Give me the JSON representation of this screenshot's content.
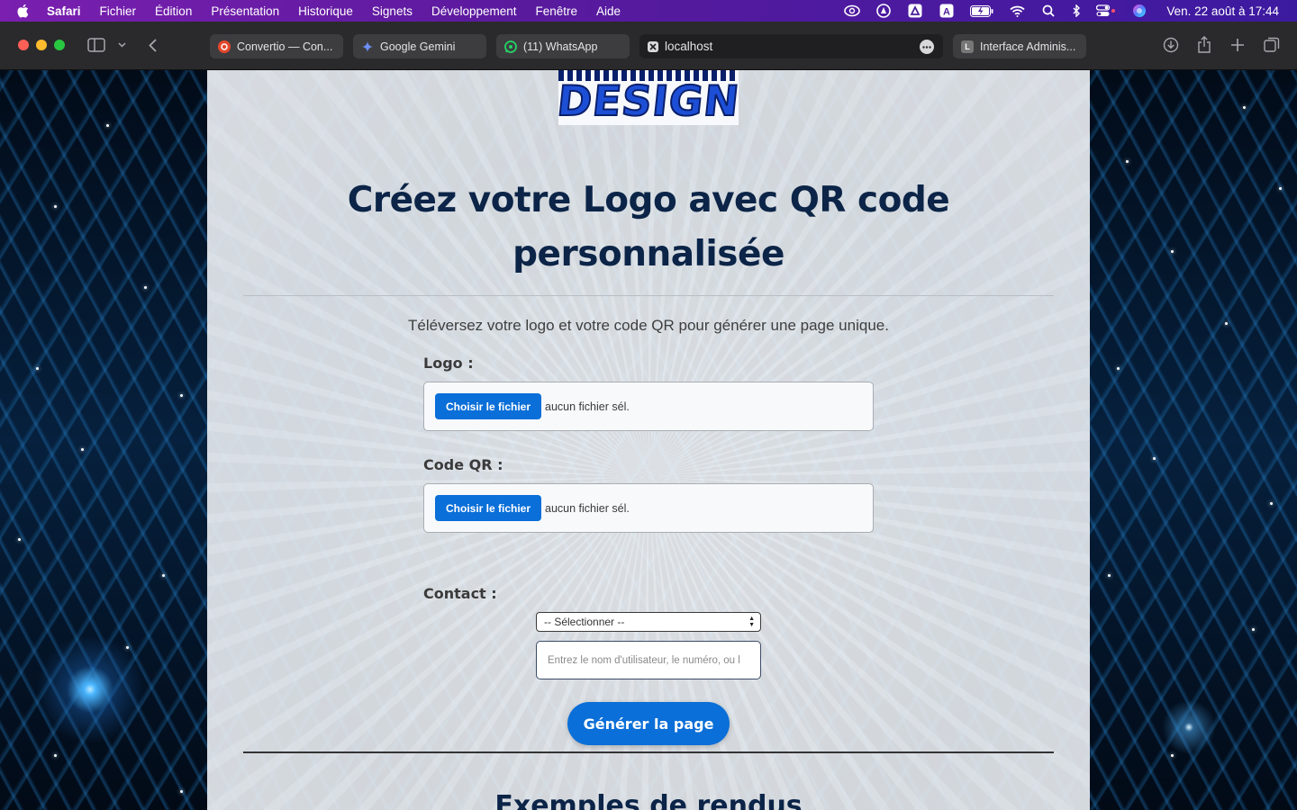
{
  "menubar": {
    "app_name": "Safari",
    "items": [
      "Fichier",
      "Édition",
      "Présentation",
      "Historique",
      "Signets",
      "Développement",
      "Fenêtre",
      "Aide"
    ],
    "status_icons": [
      "creative-cloud-icon",
      "vpn-icon",
      "drive-icon",
      "keyboard-a-icon",
      "battery-icon",
      "wifi-icon",
      "search-icon",
      "bluetooth-icon",
      "control-center-icon",
      "siri-icon"
    ],
    "datetime": "Ven. 22 août à  17:44"
  },
  "toolbar": {
    "tabs": [
      {
        "title": "Convertio — Con...",
        "favicon": "convertio-icon",
        "color": "#e4472c"
      },
      {
        "title": "Google Gemini",
        "favicon": "gemini-icon",
        "color": "#4d86f2"
      },
      {
        "title": "(11) WhatsApp",
        "favicon": "whatsapp-icon",
        "color": "#25d366"
      },
      {
        "title": "localhost",
        "favicon": "close-icon",
        "color": "#ffffff"
      },
      {
        "title": "Interface Adminis...",
        "favicon": "L",
        "color": "#777777"
      }
    ]
  },
  "page": {
    "logo_text": "DESIGN",
    "title": "Créez votre Logo avec QR code personnalisée",
    "subtitle": "Téléversez votre logo et votre code QR pour générer une page unique.",
    "logo_field": {
      "label": "Logo :",
      "button": "Choisir le fichier",
      "status": "aucun fichier sél."
    },
    "qr_field": {
      "label": "Code QR :",
      "button": "Choisir le fichier",
      "status": "aucun fichier sél."
    },
    "contact": {
      "label": "Contact :",
      "select_value": "-- Sélectionner --",
      "input_placeholder": "Entrez le nom d'utilisateur, le numéro, ou l"
    },
    "generate_button": "Générer la page",
    "section_title": "Exemples de rendus"
  },
  "colors": {
    "accent": "#0a6fd8",
    "heading": "#0b2447",
    "menubar": "#5a1a9e"
  }
}
